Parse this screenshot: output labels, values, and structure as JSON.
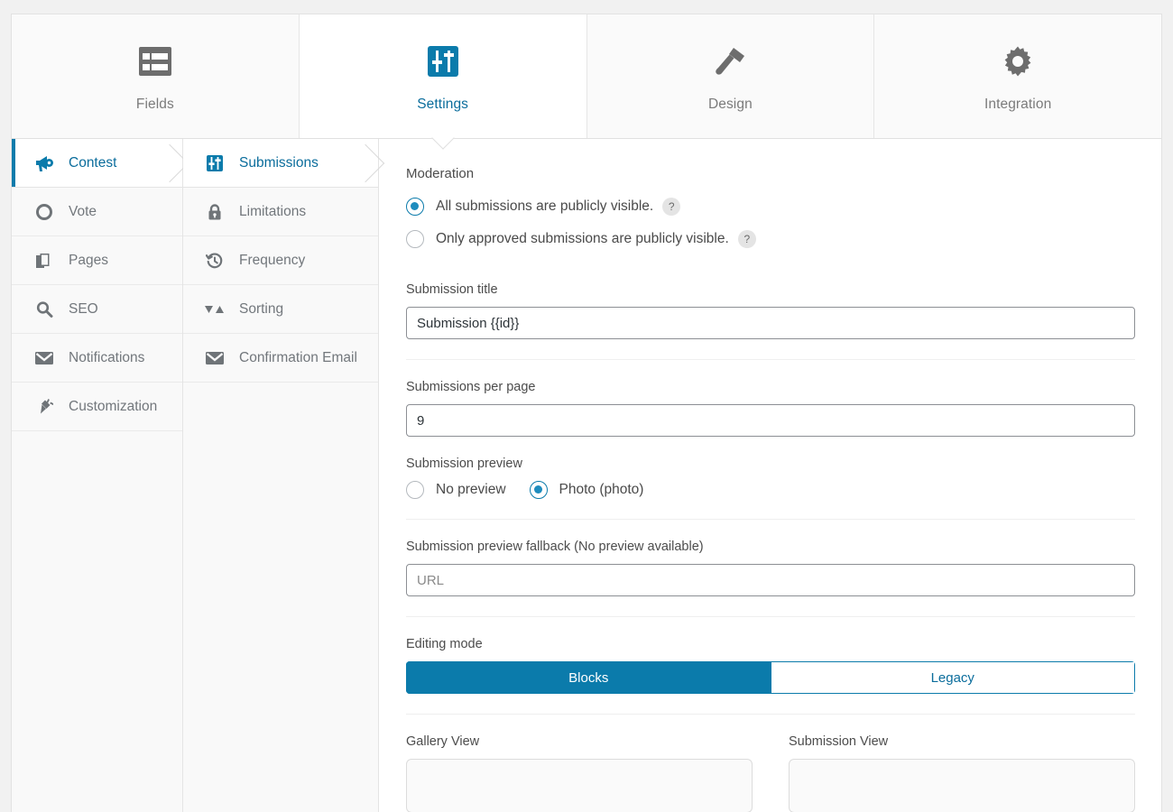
{
  "tabs": [
    {
      "label": "Fields",
      "icon": "form-list-icon",
      "active": false
    },
    {
      "label": "Settings",
      "icon": "sliders-icon",
      "active": true
    },
    {
      "label": "Design",
      "icon": "paintbrush-icon",
      "active": false
    },
    {
      "label": "Integration",
      "icon": "gear-icon",
      "active": false
    }
  ],
  "sidebar": {
    "items": [
      {
        "label": "Contest",
        "icon": "megaphone-icon",
        "active": true
      },
      {
        "label": "Vote",
        "icon": "circle-icon",
        "active": false
      },
      {
        "label": "Pages",
        "icon": "pages-icon",
        "active": false
      },
      {
        "label": "SEO",
        "icon": "magnifier-icon",
        "active": false
      },
      {
        "label": "Notifications",
        "icon": "envelope-icon",
        "active": false
      },
      {
        "label": "Customization",
        "icon": "plug-icon",
        "active": false
      }
    ]
  },
  "subnav": {
    "items": [
      {
        "label": "Submissions",
        "icon": "sliders-icon",
        "active": true
      },
      {
        "label": "Limitations",
        "icon": "lock-icon",
        "active": false
      },
      {
        "label": "Frequency",
        "icon": "clock-history-icon",
        "active": false
      },
      {
        "label": "Sorting",
        "icon": "sort-arrows-icon",
        "active": false
      },
      {
        "label": "Confirmation Email",
        "icon": "envelope-icon",
        "active": false
      }
    ]
  },
  "main": {
    "moderation": {
      "label": "Moderation",
      "options": [
        {
          "label": "All submissions are publicly visible.",
          "selected": true,
          "help": "?"
        },
        {
          "label": "Only approved submissions are publicly visible.",
          "selected": false,
          "help": "?"
        }
      ]
    },
    "submission_title": {
      "label": "Submission title",
      "value": "Submission {{id}}"
    },
    "submissions_per_page": {
      "label": "Submissions per page",
      "value": "9"
    },
    "submission_preview": {
      "label": "Submission preview",
      "options": [
        {
          "label": "No preview",
          "selected": false
        },
        {
          "label": "Photo (photo)",
          "selected": true
        }
      ]
    },
    "preview_fallback": {
      "label": "Submission preview fallback (No preview available)",
      "placeholder": "URL",
      "value": ""
    },
    "editing_mode": {
      "label": "Editing mode",
      "options": [
        {
          "label": "Blocks",
          "selected": true
        },
        {
          "label": "Legacy",
          "selected": false
        }
      ]
    },
    "gallery_view": {
      "label": "Gallery View"
    },
    "submission_view": {
      "label": "Submission View"
    }
  },
  "colors": {
    "accent": "#0b7bab",
    "accent_text": "#0b6d9c",
    "icon_grey": "#6f7478",
    "label_grey": "#4c4c4c",
    "panel_bg": "#f9f9f9"
  }
}
